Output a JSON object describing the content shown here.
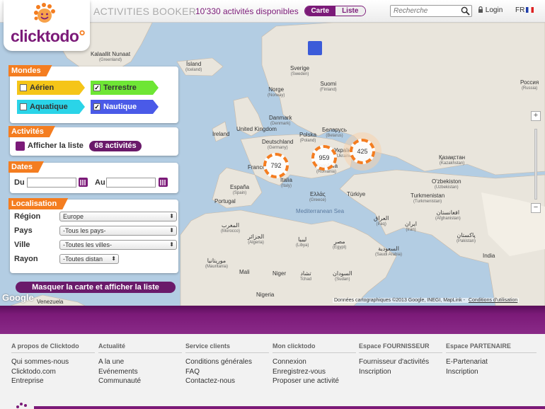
{
  "header": {
    "logo_text": "clicktodo",
    "title": "ACTIVITIES BOOKER",
    "subtitle": "10'330 activités disponibles",
    "view_toggle": [
      "Carte",
      "Liste"
    ],
    "search_placeholder": "Recherche",
    "login_label": "Login",
    "lang_label": "FR"
  },
  "map": {
    "labels": [
      {
        "text": "Kalaallit Nunaat",
        "sub": "(Greenland)"
      },
      {
        "text": "Ísland",
        "sub": "(Iceland)"
      },
      {
        "text": "Sverige",
        "sub": "(Sweden)"
      },
      {
        "text": "Suomi",
        "sub": "(Finland)"
      },
      {
        "text": "Norge",
        "sub": "(Norway)"
      },
      {
        "text": "Россия",
        "sub": "(Russia)"
      },
      {
        "text": "Danmark",
        "sub": "(Denmark)"
      },
      {
        "text": "United Kingdom",
        "sub": ""
      },
      {
        "text": "Ireland",
        "sub": ""
      },
      {
        "text": "Deutschland",
        "sub": "(Germany)"
      },
      {
        "text": "Polska",
        "sub": "(Poland)"
      },
      {
        "text": "Беларусь",
        "sub": "(Belarus)"
      },
      {
        "text": "Україна",
        "sub": "(Ukraine)"
      },
      {
        "text": "Қазақстан",
        "sub": "(Kazakhstan)"
      },
      {
        "text": "France",
        "sub": ""
      },
      {
        "text": "România",
        "sub": "(Romania)"
      },
      {
        "text": "Italia",
        "sub": "(Italy)"
      },
      {
        "text": "España",
        "sub": "(Spain)"
      },
      {
        "text": "Portugal",
        "sub": ""
      },
      {
        "text": "Ελλάς",
        "sub": "(Greece)"
      },
      {
        "text": "Türkiye",
        "sub": ""
      },
      {
        "text": "O'zbekiston",
        "sub": "(Uzbekistan)"
      },
      {
        "text": "Turkmenistan",
        "sub": "(Turkmenistan)"
      },
      {
        "text": "المغرب",
        "sub": "(Morocco)"
      },
      {
        "text": "الجزائر",
        "sub": "(Algeria)"
      },
      {
        "text": "ليبيا",
        "sub": "(Libya)"
      },
      {
        "text": "مصر",
        "sub": "(Egypt)"
      },
      {
        "text": "العراق",
        "sub": "(Iraq)"
      },
      {
        "text": "ایران",
        "sub": "(Iran)"
      },
      {
        "text": "افغانستان",
        "sub": "(Afghanistan)"
      },
      {
        "text": "پاکستان",
        "sub": "(Pakistan)"
      },
      {
        "text": "India",
        "sub": ""
      },
      {
        "text": "السعودية",
        "sub": "(Saudi Arabia)"
      },
      {
        "text": "موريتانيا",
        "sub": "(Mauritania)"
      },
      {
        "text": "Mali",
        "sub": ""
      },
      {
        "text": "Niger",
        "sub": ""
      },
      {
        "text": "تشاد",
        "sub": "Tchad"
      },
      {
        "text": "السودان",
        "sub": "(Sudan)"
      },
      {
        "text": "Nigeria",
        "sub": ""
      },
      {
        "text": "Venezuela",
        "sub": ""
      },
      {
        "text": "Mediterranean Sea",
        "sub": ""
      }
    ],
    "clusters": [
      "792",
      "959",
      "425"
    ],
    "zoom_in": "+",
    "zoom_out": "−",
    "google": "Google",
    "attribution": "Données cartographiques ©2013 Google, INEGI, MapLink",
    "terms": "Conditions d'utilisation"
  },
  "panels": {
    "mondes": {
      "title": "Mondes",
      "chips": [
        {
          "label": "Aérien",
          "checked": false,
          "color": "#f5c518"
        },
        {
          "label": "Terrestre",
          "checked": true,
          "color": "#6ee635"
        },
        {
          "label": "Aquatique",
          "checked": false,
          "color": "#2ad4e8"
        },
        {
          "label": "Nautique",
          "checked": true,
          "color": "#4a5ae8"
        }
      ]
    },
    "activites": {
      "title": "Activités",
      "show_list": "Afficher la liste",
      "count": "68 activités"
    },
    "dates": {
      "title": "Dates",
      "from_label": "Du",
      "to_label": "Au"
    },
    "localisation": {
      "title": "Localisation",
      "rows": [
        {
          "label": "Région",
          "value": "Europe"
        },
        {
          "label": "Pays",
          "value": "-Tous les pays-"
        },
        {
          "label": "Ville",
          "value": "-Toutes les villes-"
        },
        {
          "label": "Rayon",
          "value": "-Toutes distan"
        }
      ]
    },
    "hide_map_button": "Masquer la carte et afficher la liste"
  },
  "footer": {
    "columns": [
      {
        "title": "A propos de Clicktodo",
        "links": [
          "Qui sommes-nous",
          "Clicktodo.com",
          "Entreprise"
        ]
      },
      {
        "title": "Actualité",
        "links": [
          "A la une",
          "Evénements",
          "Communauté"
        ]
      },
      {
        "title": "Service clients",
        "links": [
          "Conditions générales",
          "FAQ",
          "Contactez-nous"
        ]
      },
      {
        "title": "Mon clicktodo",
        "links": [
          "Connexion",
          "Enregistrez-vous",
          "Proposer une activité"
        ]
      },
      {
        "title": "Espace FOURNISSEUR",
        "links": [
          "Fournisseur d'activités",
          "Inscription"
        ]
      },
      {
        "title": "Espace PARTENAIRE",
        "links": [
          "E-Partenariat",
          "Inscription"
        ]
      }
    ]
  },
  "colors": {
    "brand_purple": "#7b1a78",
    "brand_orange": "#f47d20"
  }
}
